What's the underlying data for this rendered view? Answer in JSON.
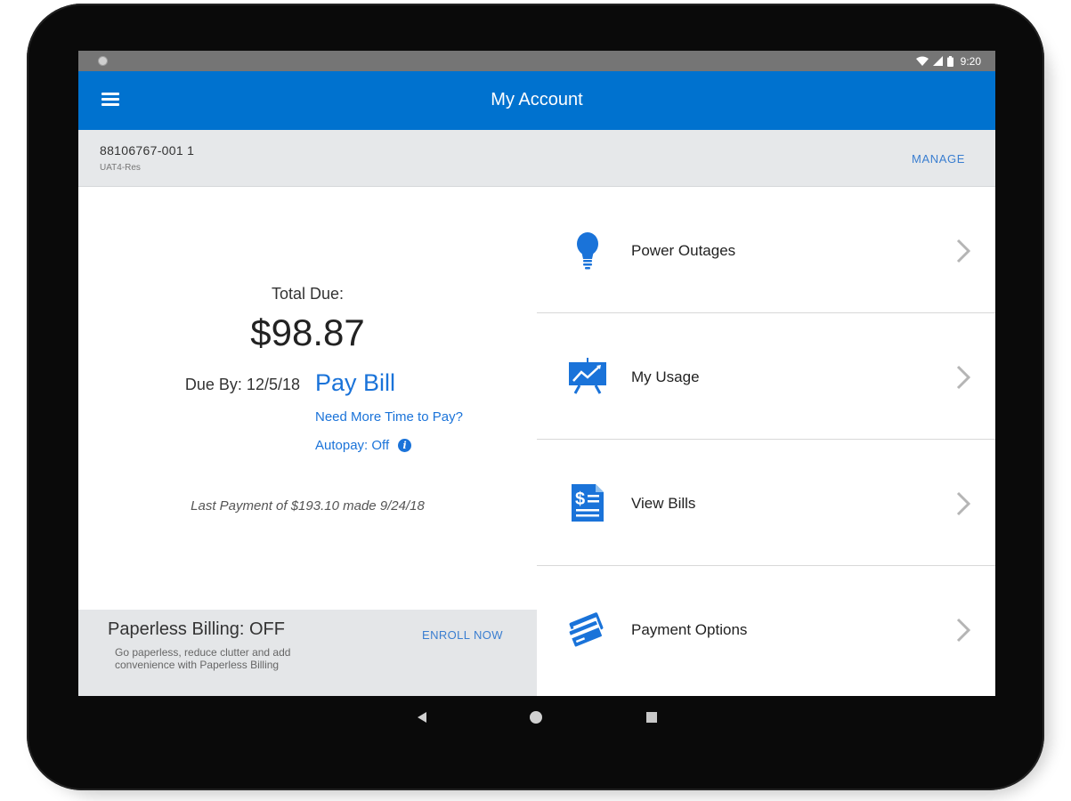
{
  "status_bar": {
    "time": "9:20"
  },
  "app_bar": {
    "title": "My Account"
  },
  "account": {
    "number": "88106767-001 1",
    "subtitle": "UAT4-Res",
    "manage_label": "MANAGE"
  },
  "billing": {
    "total_label": "Total Due:",
    "total_amount": "$98.87",
    "due_by": "Due By: 12/5/18",
    "pay_bill_label": "Pay Bill",
    "more_time_label": "Need More Time to Pay?",
    "autopay_label": "Autopay: Off",
    "last_payment": "Last Payment of $193.10 made 9/24/18"
  },
  "paperless": {
    "title": "Paperless Billing: OFF",
    "description": "Go paperless, reduce clutter and add convenience with Paperless Billing",
    "enroll_label": "ENROLL NOW"
  },
  "menu": {
    "items": [
      {
        "label": "Power Outages",
        "icon": "lightbulb-icon"
      },
      {
        "label": "My Usage",
        "icon": "usage-chart-icon"
      },
      {
        "label": "View Bills",
        "icon": "bill-icon"
      },
      {
        "label": "Payment Options",
        "icon": "credit-card-icon"
      }
    ]
  },
  "colors": {
    "brand_blue": "#0072cf",
    "link_blue": "#1a73d9",
    "status_bar": "#757575"
  }
}
